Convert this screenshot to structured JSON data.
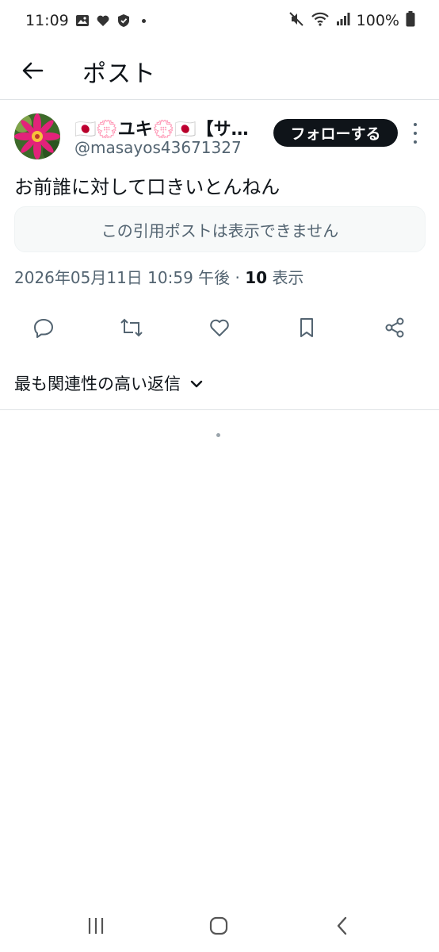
{
  "status_bar": {
    "time": "11:09",
    "battery": "100%",
    "icons": [
      "image-icon",
      "heart-icon",
      "shield-icon",
      "dot-icon",
      "mute-icon",
      "wifi-icon",
      "signal-icon",
      "battery-icon"
    ]
  },
  "app_bar": {
    "title": "ポスト",
    "back_icon": "arrow-left-icon"
  },
  "post": {
    "display_name": "🇯🇵💮ユキ💮🇯🇵【サ…",
    "handle": "@masayos43671327",
    "follow_label": "フォローする",
    "text": "お前誰に対して口きいとんねん",
    "quote_unavailable": "この引用ポストは表示できません",
    "timestamp": "2026年05月11日 10:59 午後",
    "views_count": "10",
    "views_label": "表示",
    "actions": [
      "reply-icon",
      "repost-icon",
      "like-icon",
      "bookmark-icon",
      "share-icon"
    ]
  },
  "replies": {
    "sort_label": "最も関連性の高い返信"
  },
  "colors": {
    "text": "#0f1419",
    "secondary": "#536471",
    "follow_bg": "#0f1419",
    "quote_bg": "#f7f9f9"
  }
}
